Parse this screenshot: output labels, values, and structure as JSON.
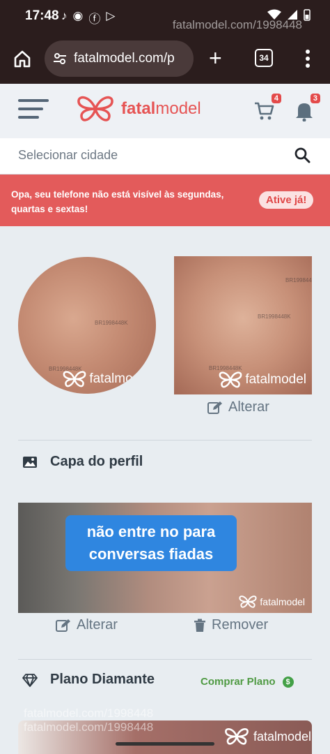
{
  "status_bar": {
    "time": "17:48"
  },
  "watermark": {
    "lines": [
      "fatalmodel.com/1998448",
      "fatalmodel.com/1998448"
    ]
  },
  "browser": {
    "url": "fatalmodel.com/p",
    "tab_count": "34"
  },
  "header": {
    "logo_bold": "fatal",
    "logo_rest": "model",
    "cart_badge": "4",
    "bell_badge": "3"
  },
  "search": {
    "placeholder": "Selecionar cidade"
  },
  "alert": {
    "message": "Opa, seu telefone não está visível às segundas, quartas e sextas!",
    "button": "Ative já!"
  },
  "profile_photos": {
    "watermark": "fatalmodel",
    "code": "BR1998448K",
    "edit_label": "Alterar"
  },
  "cover": {
    "title": "Capa do perfil",
    "banner_line1": "não entre no para",
    "banner_line2": "conversas fiadas",
    "watermark": "fatalmodel",
    "edit_label": "Alterar",
    "remove_label": "Remover"
  },
  "plan": {
    "title": "Plano Diamante",
    "buy_label": "Comprar Plano"
  },
  "colors": {
    "brand": "#e65454",
    "alert_bg": "#e35b5b",
    "buy_green": "#4f9a43"
  }
}
